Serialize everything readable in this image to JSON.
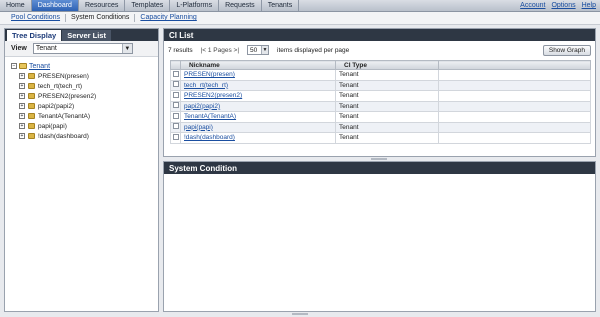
{
  "topnav": {
    "tabs": [
      {
        "label": "Home",
        "active": false
      },
      {
        "label": "Dashboard",
        "active": true
      },
      {
        "label": "Resources",
        "active": false
      },
      {
        "label": "Templates",
        "active": false
      },
      {
        "label": "L-Platforms",
        "active": false
      },
      {
        "label": "Requests",
        "active": false
      },
      {
        "label": "Tenants",
        "active": false
      }
    ],
    "links": [
      "Account",
      "Options",
      "Help"
    ]
  },
  "subnav": {
    "items": [
      {
        "label": "Pool Conditions",
        "active": false
      },
      {
        "label": "System Conditions",
        "active": true
      },
      {
        "label": "Capacity Planning",
        "active": false
      }
    ]
  },
  "left": {
    "tabs": [
      "Tree Display",
      "Server List"
    ],
    "view_label": "View",
    "view_value": "Tenant",
    "tree_root": "Tenant",
    "tree_nodes": [
      "PRESEN(presen)",
      "tech_rt(tech_rt)",
      "PRESEN2(presen2)",
      "papi2(papi2)",
      "TenantA(TenantA)",
      "papi(papi)",
      "!dash(dashboard)"
    ]
  },
  "ci": {
    "title": "CI List",
    "results": "7 results",
    "pager": "|< 1 Pages >|",
    "per_page": "50",
    "per_page_label": "items displayed per page",
    "show_graph": "Show Graph",
    "columns": [
      "Nickname",
      "CI Type"
    ],
    "rows": [
      {
        "nickname": "PRESEN(presen)",
        "type": "Tenant"
      },
      {
        "nickname": "tech_rt(tech_rt)",
        "type": "Tenant"
      },
      {
        "nickname": "PRESEN2(presen2)",
        "type": "Tenant"
      },
      {
        "nickname": "papi2(papi2)",
        "type": "Tenant"
      },
      {
        "nickname": "TenantA(TenantA)",
        "type": "Tenant"
      },
      {
        "nickname": "papi(papi)",
        "type": "Tenant"
      },
      {
        "nickname": "!dash(dashboard)",
        "type": "Tenant"
      }
    ]
  },
  "system": {
    "title": "System Condition"
  }
}
